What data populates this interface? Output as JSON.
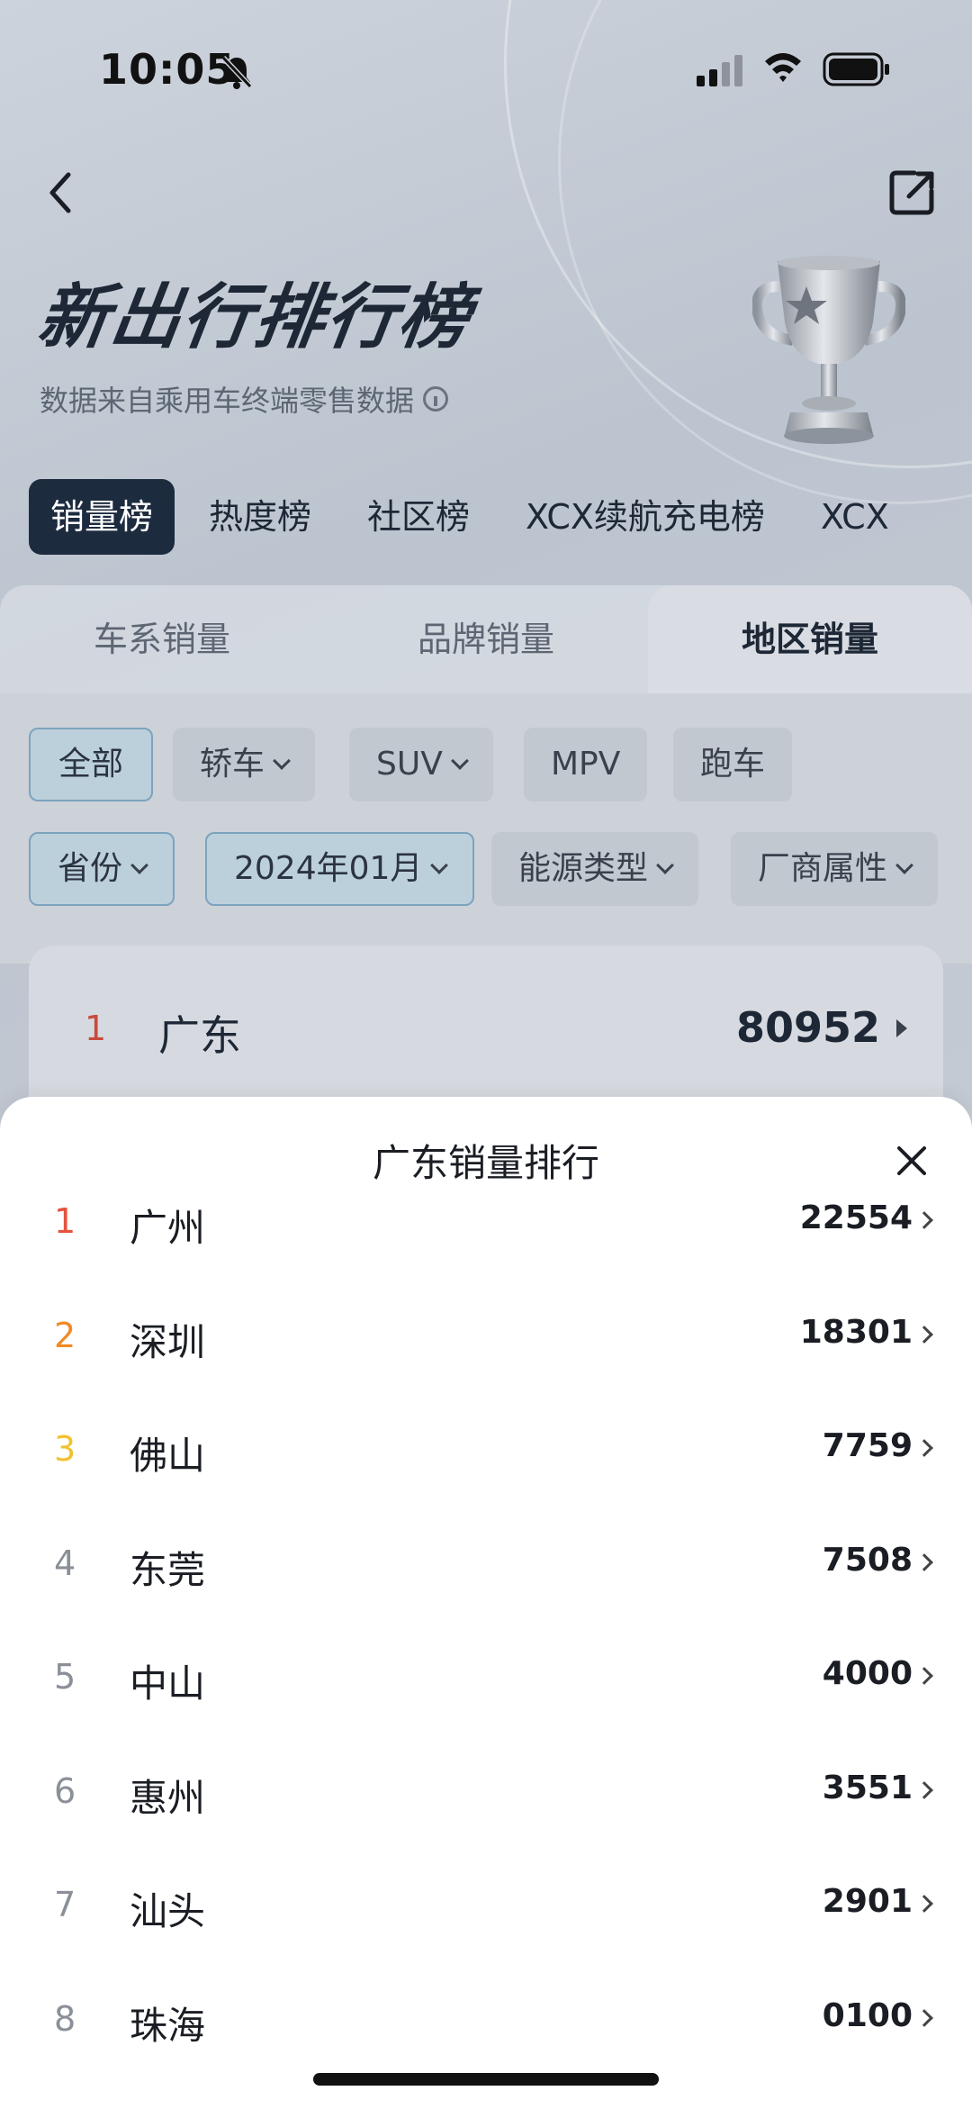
{
  "status_bar": {
    "time": "10:05"
  },
  "hero": {
    "title": "新出行排行榜",
    "subtitle": "数据来自乘用车终端零售数据"
  },
  "main_tabs": [
    {
      "label": "销量榜",
      "active": true
    },
    {
      "label": "热度榜",
      "active": false
    },
    {
      "label": "社区榜",
      "active": false
    },
    {
      "label": "XCX续航充电榜",
      "active": false
    },
    {
      "label": "XCX",
      "active": false
    }
  ],
  "sub_tabs": [
    {
      "label": "车系销量",
      "active": false
    },
    {
      "label": "品牌销量",
      "active": false
    },
    {
      "label": "地区销量",
      "active": true
    }
  ],
  "filters_row1": [
    {
      "label": "全部",
      "selected": true,
      "dropdown": false
    },
    {
      "label": "轿车",
      "selected": false,
      "dropdown": true
    },
    {
      "label": "SUV",
      "selected": false,
      "dropdown": true
    },
    {
      "label": "MPV",
      "selected": false,
      "dropdown": false
    },
    {
      "label": "跑车",
      "selected": false,
      "dropdown": false
    }
  ],
  "filters_row2": [
    {
      "label": "省份",
      "selected": true,
      "dropdown": true
    },
    {
      "label": "2024年01月",
      "selected": true,
      "dropdown": true
    },
    {
      "label": "能源类型",
      "selected": false,
      "dropdown": true
    },
    {
      "label": "厂商属性",
      "selected": false,
      "dropdown": true
    }
  ],
  "province_item": {
    "rank": "1",
    "name": "广东",
    "value": "80952"
  },
  "sheet": {
    "title": "广东销量排行",
    "rows": [
      {
        "rank": "1",
        "city": "广州",
        "value": "22554"
      },
      {
        "rank": "2",
        "city": "深圳",
        "value": "18301"
      },
      {
        "rank": "3",
        "city": "佛山",
        "value": "7759"
      },
      {
        "rank": "4",
        "city": "东莞",
        "value": "7508"
      },
      {
        "rank": "5",
        "city": "中山",
        "value": "4000"
      },
      {
        "rank": "6",
        "city": "惠州",
        "value": "3551"
      },
      {
        "rank": "7",
        "city": "汕头",
        "value": "2901"
      },
      {
        "rank": "8",
        "city": "珠海",
        "value": "0100"
      }
    ]
  },
  "colors": {
    "rank_1": "#e5533d",
    "rank_2": "#f08a24",
    "rank_3": "#f2c12e",
    "rank_other": "#8a8f98",
    "accent_dark": "#1d2b3f"
  }
}
